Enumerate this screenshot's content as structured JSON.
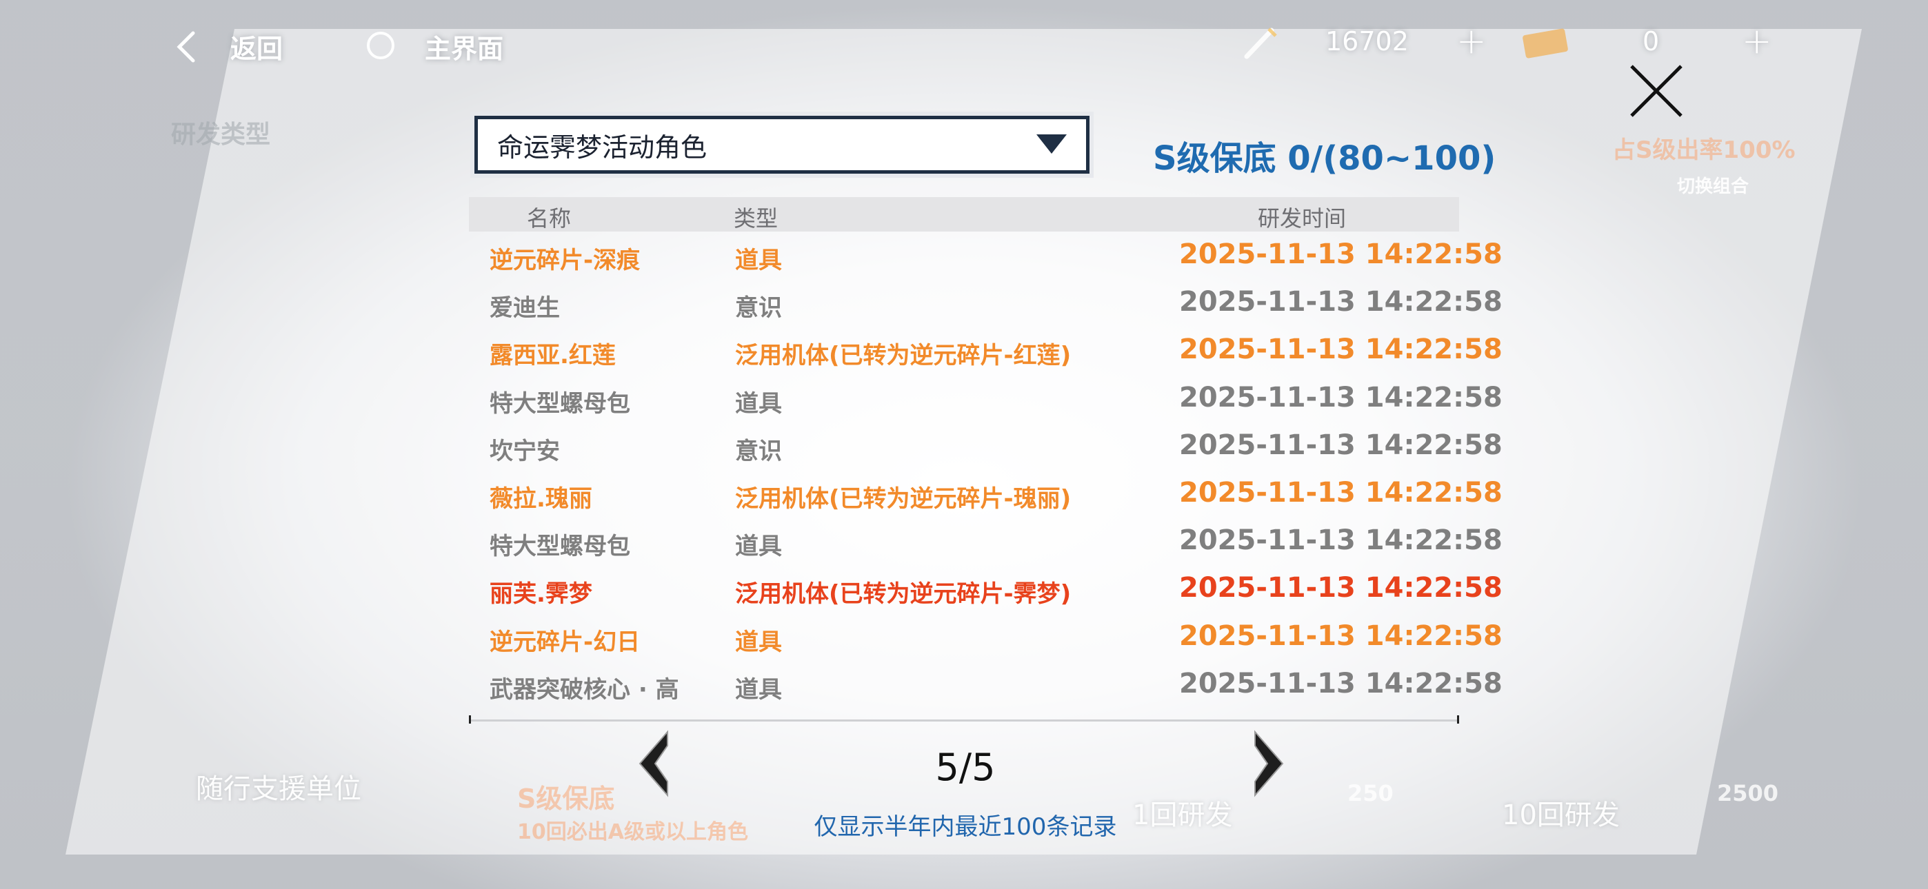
{
  "topbar": {
    "back_label": "返回",
    "home_label": "主界面",
    "currency_1_value": "16702",
    "currency_2_value": "0",
    "plus_symbol": "+"
  },
  "dialog": {
    "dropdown_selected": "命运霁梦活动角色",
    "pity_text": "S级保底 0/(80~100)",
    "columns": {
      "name": "名称",
      "type": "类型",
      "time": "研发时间"
    },
    "rows": [
      {
        "name": "逆元碎片-深痕",
        "type": "道具",
        "time": "2025-11-13 14:22:58",
        "color": "#f28a2a"
      },
      {
        "name": "爱迪生",
        "type": "意识",
        "time": "2025-11-13 14:22:58",
        "color": "#7f7f7f"
      },
      {
        "name": "露西亚.红莲",
        "type": "泛用机体(已转为逆元碎片-红莲)",
        "time": "2025-11-13 14:22:58",
        "color": "#f28a2a"
      },
      {
        "name": "特大型螺母包",
        "type": "道具",
        "time": "2025-11-13 14:22:58",
        "color": "#7f7f7f"
      },
      {
        "name": "坎宁安",
        "type": "意识",
        "time": "2025-11-13 14:22:58",
        "color": "#7f7f7f"
      },
      {
        "name": "薇拉.瑰丽",
        "type": "泛用机体(已转为逆元碎片-瑰丽)",
        "time": "2025-11-13 14:22:58",
        "color": "#f28a2a"
      },
      {
        "name": "特大型螺母包",
        "type": "道具",
        "time": "2025-11-13 14:22:58",
        "color": "#7f7f7f"
      },
      {
        "name": "丽芙.霁梦",
        "type": "泛用机体(已转为逆元碎片-霁梦)",
        "time": "2025-11-13 14:22:58",
        "color": "#e8421c"
      },
      {
        "name": "逆元碎片-幻日",
        "type": "道具",
        "time": "2025-11-13 14:22:58",
        "color": "#f28a2a"
      },
      {
        "name": "武器突破核心 · 高",
        "type": "道具",
        "time": "2025-11-13 14:22:58",
        "color": "#7f7f7f"
      }
    ],
    "page_indicator": "5/5",
    "notice": "仅显示半年内最近100条记录"
  },
  "background": {
    "research_type_label": "研发类型",
    "companion_unit_label": "随行支援单位",
    "s_pity_label": "S级保底",
    "guarantee_text": "10回必出A级或以上角色",
    "single_research_label": "1回研发",
    "ten_research_label": "10回研发",
    "single_cost": "250",
    "ten_cost": "2500",
    "rate_up_text": "占S级出率100%",
    "switch_combo_label": "切换组合"
  }
}
